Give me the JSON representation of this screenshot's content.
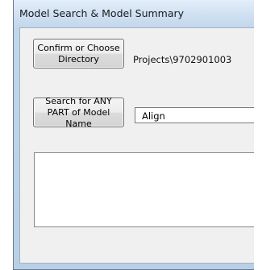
{
  "window": {
    "title": "Model Search & Model Summary"
  },
  "directory": {
    "button_label": "Confirm or Choose\nDirectory",
    "path": "Projects\\9702901003"
  },
  "search": {
    "button_label": "Search for ANY\nPART of Model Name",
    "value": "Align"
  },
  "results": {
    "items": []
  }
}
